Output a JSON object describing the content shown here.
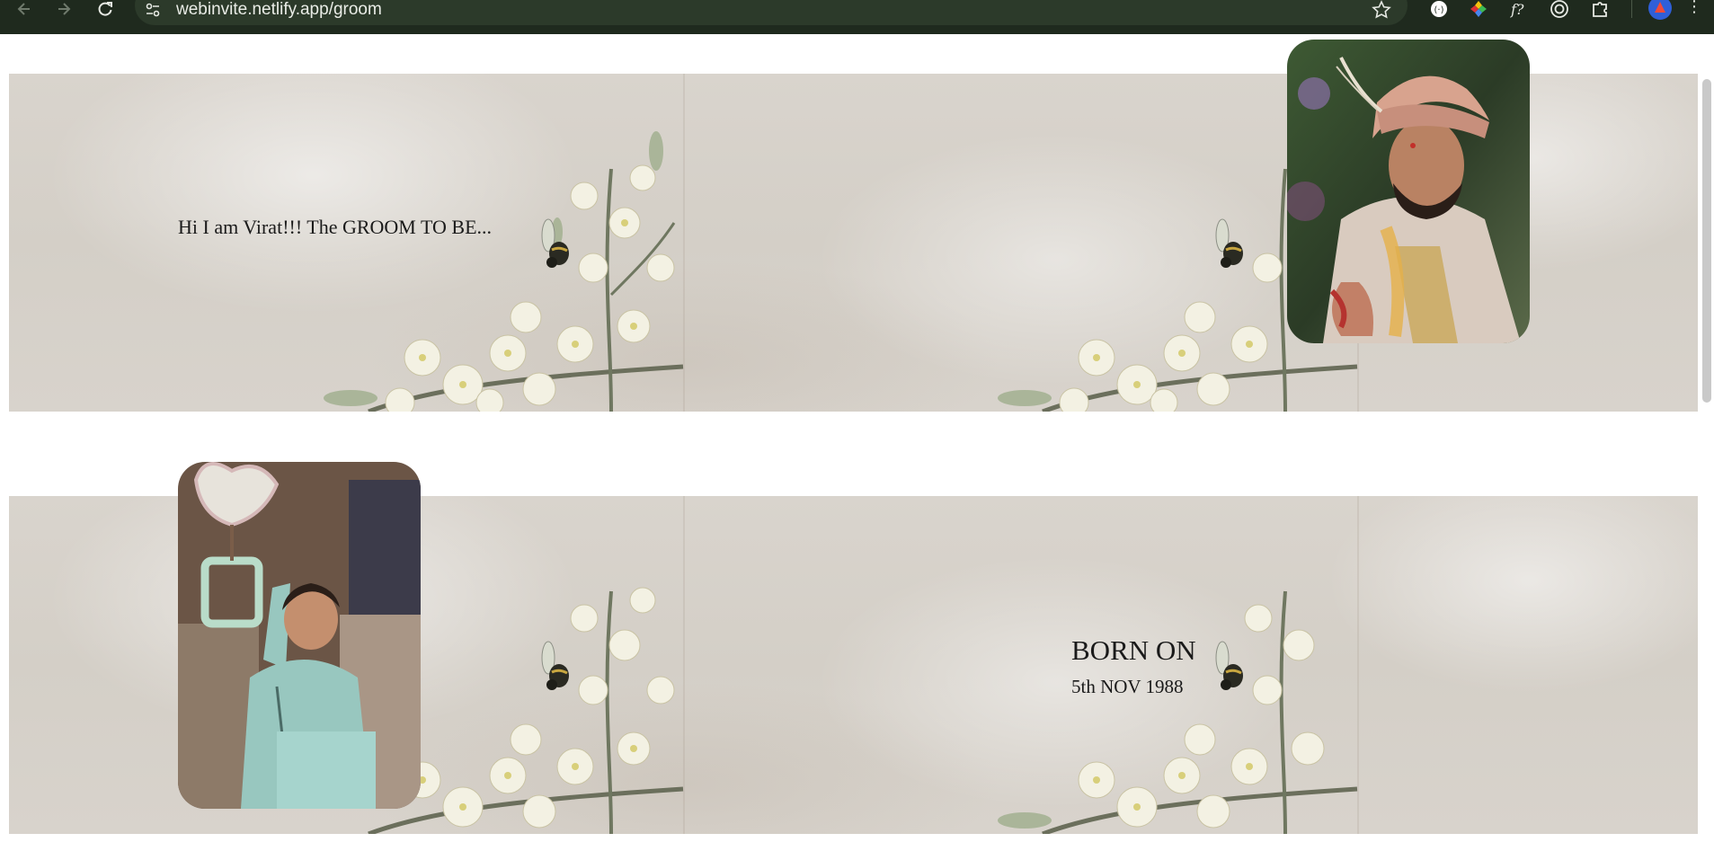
{
  "browser": {
    "url": "webinvite.netlify.app/groom"
  },
  "hero": {
    "intro": "Hi I am Virat!!! The GROOM TO BE...",
    "groom_photo_alt": "Groom in wedding attire"
  },
  "birth": {
    "heading": "BORN ON",
    "date": "5th NOV 1988",
    "child_photo_alt": "Childhood photo"
  },
  "colors": {
    "chrome_bg": "#1f2a1e",
    "panel_bg": "#d7d2cb",
    "text": "#1a1a1a"
  },
  "icons": [
    "back-icon",
    "forward-icon",
    "reload-icon",
    "site-settings-icon",
    "bookmark-star-icon",
    "extension-icon",
    "color-picker-icon",
    "font-icon",
    "target-icon",
    "puzzle-icon",
    "profile-avatar",
    "menu-icon"
  ]
}
